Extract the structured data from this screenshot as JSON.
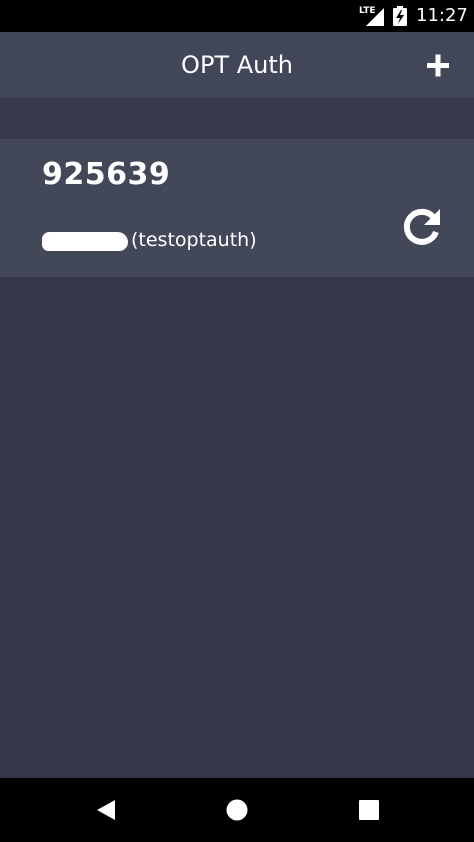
{
  "status_bar": {
    "network": "LTE",
    "time": "11:27",
    "icons": [
      "lte-signal-icon",
      "battery-charging-icon"
    ]
  },
  "app_bar": {
    "title": "OPT Auth",
    "add_icon": "plus-icon"
  },
  "accounts": [
    {
      "code": "925639",
      "account_name": "(testoptauth)",
      "refresh_icon": "refresh-icon"
    }
  ],
  "nav_bar": {
    "icons": [
      "back-icon",
      "home-icon",
      "recents-icon"
    ]
  },
  "colors": {
    "background": "#343747",
    "app_bar": "#414659",
    "card": "#434859",
    "text": "#ffffff"
  }
}
